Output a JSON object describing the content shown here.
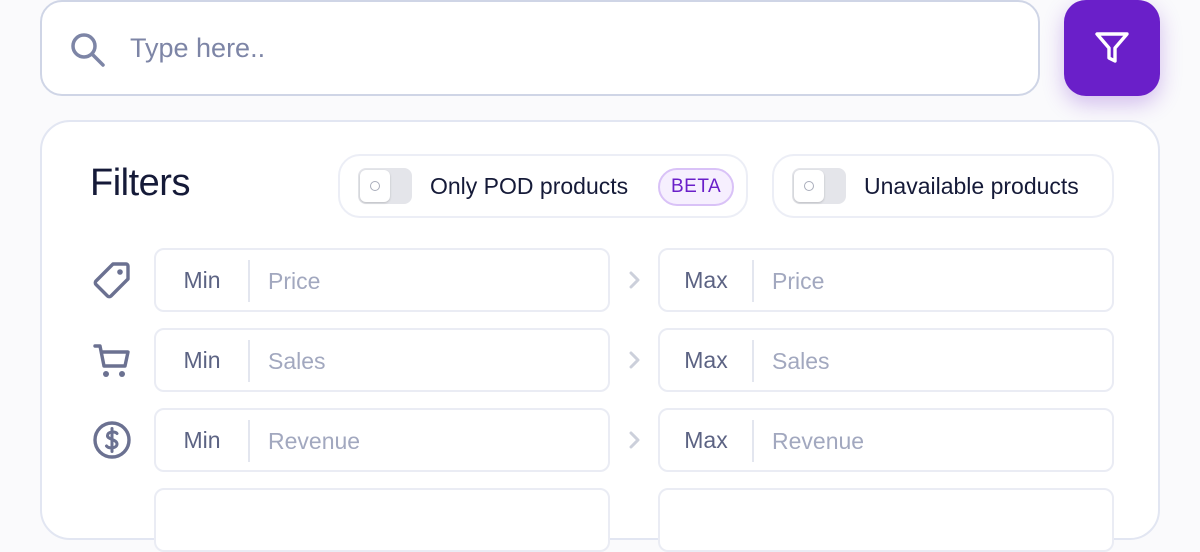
{
  "search": {
    "placeholder": "Type here..",
    "value": ""
  },
  "filter_button": {
    "icon": "funnel-icon",
    "color": "#6a1fc9"
  },
  "filters": {
    "title": "Filters",
    "toggles": [
      {
        "label": "Only POD products",
        "badge": "BETA",
        "checked": false
      },
      {
        "label": "Unavailable products",
        "checked": false
      }
    ],
    "ranges": [
      {
        "icon": "price-tag-icon",
        "min_prefix": "Min",
        "min_placeholder": "Price",
        "max_prefix": "Max",
        "max_placeholder": "Price"
      },
      {
        "icon": "cart-icon",
        "min_prefix": "Min",
        "min_placeholder": "Sales",
        "max_prefix": "Max",
        "max_placeholder": "Sales"
      },
      {
        "icon": "dollar-coin-icon",
        "min_prefix": "Min",
        "min_placeholder": "Revenue",
        "max_prefix": "Max",
        "max_placeholder": "Revenue"
      }
    ]
  },
  "colors": {
    "accent": "#6a1fc9",
    "icon": "#6b7191",
    "border": "#cfd5e6"
  }
}
